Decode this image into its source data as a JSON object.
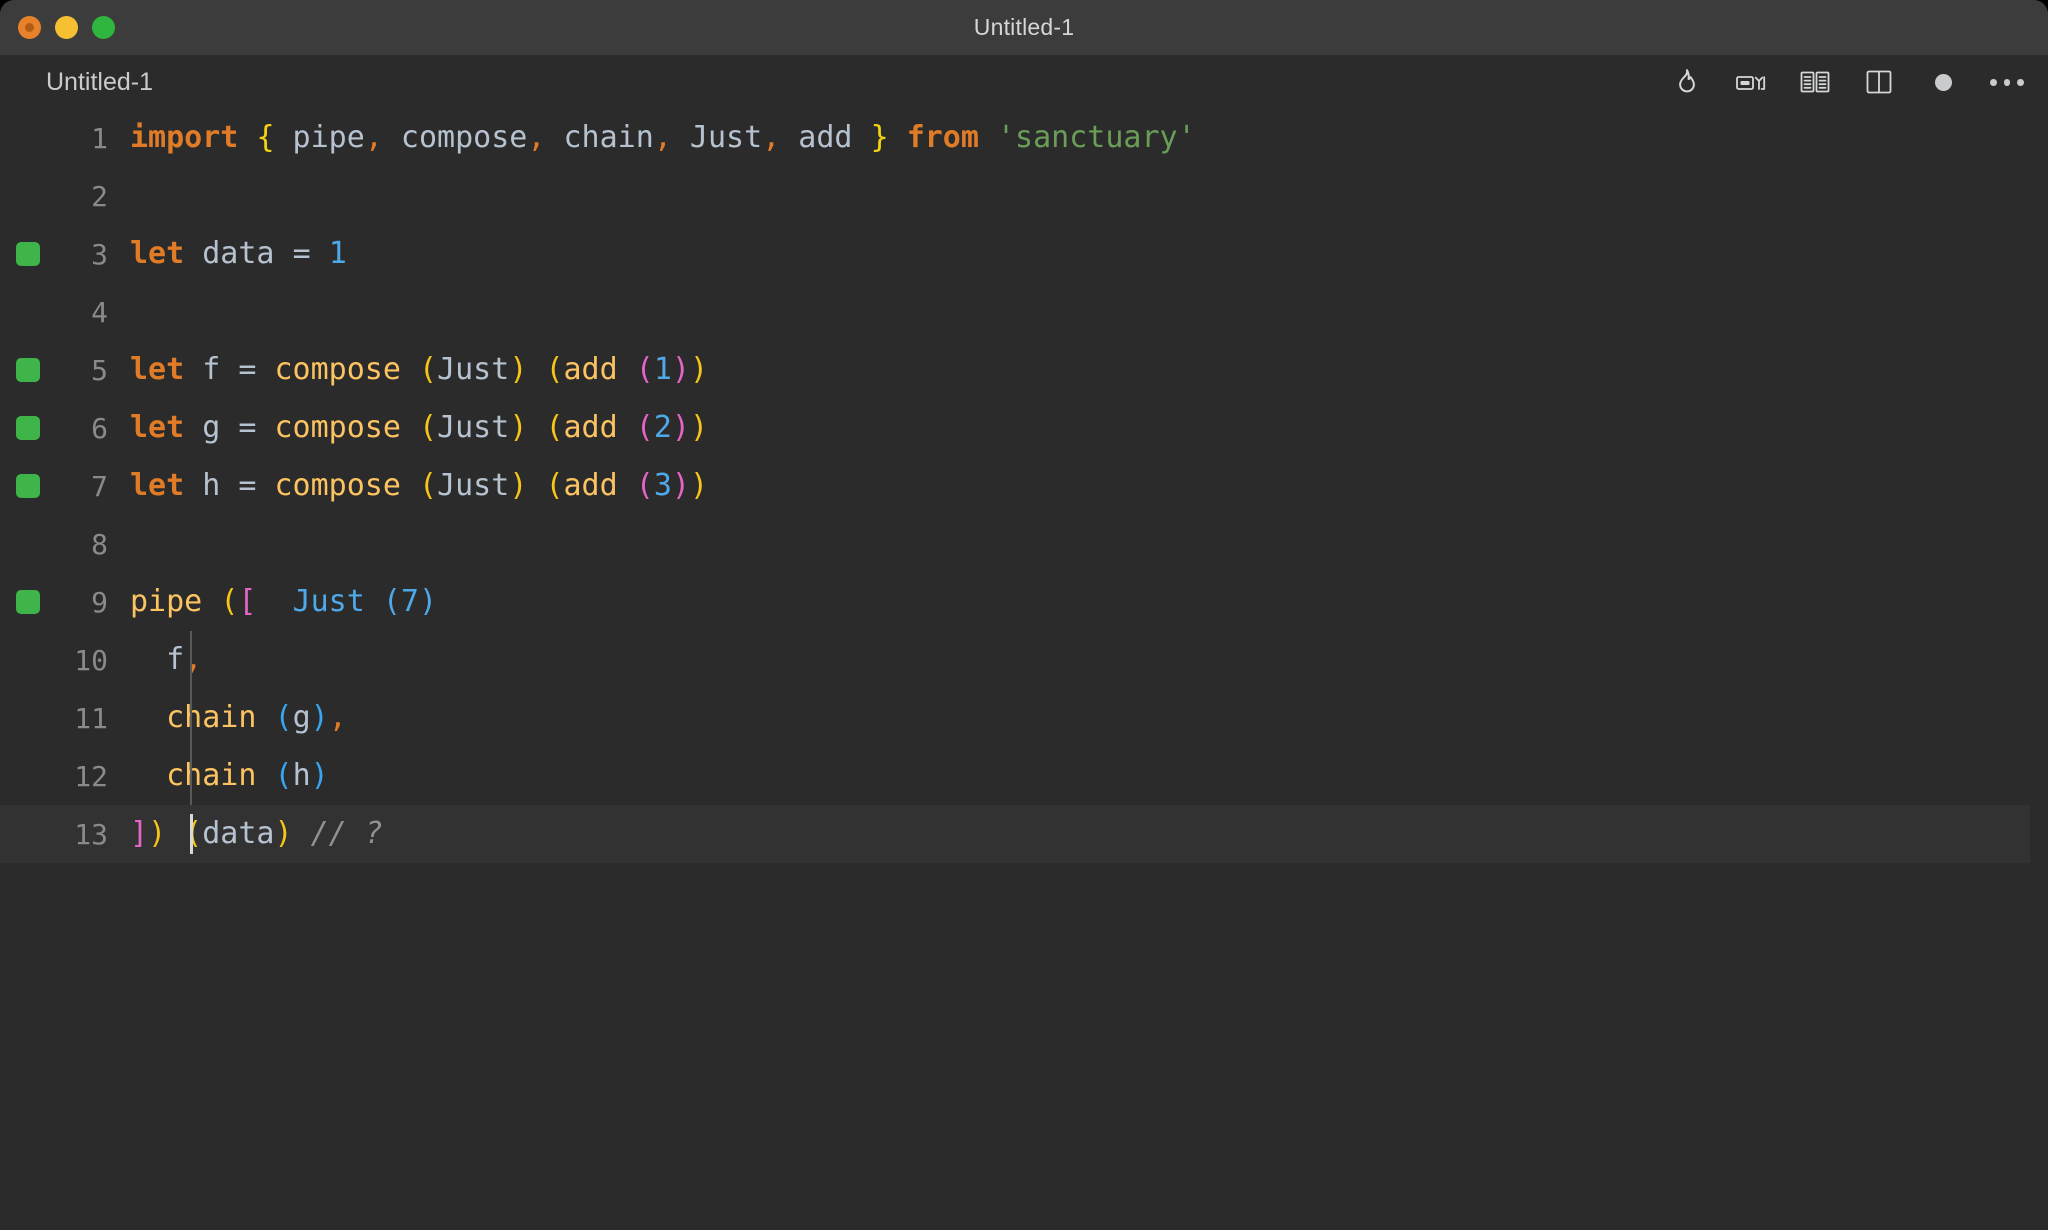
{
  "window": {
    "title": "Untitled-1",
    "traffic_lights": [
      "close-button",
      "minimize-button",
      "maximize-button"
    ]
  },
  "tabbar": {
    "tab_label": "Untitled-1",
    "toolbar_icons": [
      "flame-icon",
      "run-quokka-icon",
      "open-book-icon",
      "split-editor-icon",
      "unsaved-dot-icon",
      "more-actions-icon"
    ]
  },
  "editor": {
    "active_line": 13,
    "gutter_marked_lines": [
      3,
      5,
      6,
      7,
      9
    ],
    "lines": [
      {
        "no": "1",
        "tokens": [
          {
            "text": "import",
            "cls": "t-kw"
          },
          {
            "text": " ",
            "cls": "t-plain"
          },
          {
            "text": "{",
            "cls": "t-brace"
          },
          {
            "text": " pipe",
            "cls": "t-plain"
          },
          {
            "text": ",",
            "cls": "t-punct"
          },
          {
            "text": " compose",
            "cls": "t-plain"
          },
          {
            "text": ",",
            "cls": "t-punct"
          },
          {
            "text": " chain",
            "cls": "t-plain"
          },
          {
            "text": ",",
            "cls": "t-punct"
          },
          {
            "text": " Just",
            "cls": "t-plain"
          },
          {
            "text": ",",
            "cls": "t-punct"
          },
          {
            "text": " add ",
            "cls": "t-plain"
          },
          {
            "text": "}",
            "cls": "t-brace"
          },
          {
            "text": " ",
            "cls": "t-plain"
          },
          {
            "text": "from",
            "cls": "t-kw"
          },
          {
            "text": " ",
            "cls": "t-plain"
          },
          {
            "text": "'sanctuary'",
            "cls": "t-str"
          }
        ]
      },
      {
        "no": "2",
        "tokens": []
      },
      {
        "no": "3",
        "tokens": [
          {
            "text": "let",
            "cls": "t-kw"
          },
          {
            "text": " data ",
            "cls": "t-plain"
          },
          {
            "text": "=",
            "cls": "t-op"
          },
          {
            "text": " ",
            "cls": "t-plain"
          },
          {
            "text": "1",
            "cls": "t-num"
          }
        ]
      },
      {
        "no": "4",
        "tokens": []
      },
      {
        "no": "5",
        "tokens": [
          {
            "text": "let",
            "cls": "t-kw"
          },
          {
            "text": " f ",
            "cls": "t-plain"
          },
          {
            "text": "=",
            "cls": "t-op"
          },
          {
            "text": " ",
            "cls": "t-plain"
          },
          {
            "text": "compose",
            "cls": "t-fn"
          },
          {
            "text": " ",
            "cls": "t-plain"
          },
          {
            "text": "(",
            "cls": "t-paren-y"
          },
          {
            "text": "Just",
            "cls": "t-plain"
          },
          {
            "text": ")",
            "cls": "t-paren-y"
          },
          {
            "text": " ",
            "cls": "t-plain"
          },
          {
            "text": "(",
            "cls": "t-paren-y"
          },
          {
            "text": "add",
            "cls": "t-fn"
          },
          {
            "text": " ",
            "cls": "t-plain"
          },
          {
            "text": "(",
            "cls": "t-paren-p"
          },
          {
            "text": "1",
            "cls": "t-num"
          },
          {
            "text": ")",
            "cls": "t-paren-p"
          },
          {
            "text": ")",
            "cls": "t-paren-y"
          }
        ]
      },
      {
        "no": "6",
        "tokens": [
          {
            "text": "let",
            "cls": "t-kw"
          },
          {
            "text": " g ",
            "cls": "t-plain"
          },
          {
            "text": "=",
            "cls": "t-op"
          },
          {
            "text": " ",
            "cls": "t-plain"
          },
          {
            "text": "compose",
            "cls": "t-fn"
          },
          {
            "text": " ",
            "cls": "t-plain"
          },
          {
            "text": "(",
            "cls": "t-paren-y"
          },
          {
            "text": "Just",
            "cls": "t-plain"
          },
          {
            "text": ")",
            "cls": "t-paren-y"
          },
          {
            "text": " ",
            "cls": "t-plain"
          },
          {
            "text": "(",
            "cls": "t-paren-y"
          },
          {
            "text": "add",
            "cls": "t-fn"
          },
          {
            "text": " ",
            "cls": "t-plain"
          },
          {
            "text": "(",
            "cls": "t-paren-p"
          },
          {
            "text": "2",
            "cls": "t-num"
          },
          {
            "text": ")",
            "cls": "t-paren-p"
          },
          {
            "text": ")",
            "cls": "t-paren-y"
          }
        ]
      },
      {
        "no": "7",
        "tokens": [
          {
            "text": "let",
            "cls": "t-kw"
          },
          {
            "text": " h ",
            "cls": "t-plain"
          },
          {
            "text": "=",
            "cls": "t-op"
          },
          {
            "text": " ",
            "cls": "t-plain"
          },
          {
            "text": "compose",
            "cls": "t-fn"
          },
          {
            "text": " ",
            "cls": "t-plain"
          },
          {
            "text": "(",
            "cls": "t-paren-y"
          },
          {
            "text": "Just",
            "cls": "t-plain"
          },
          {
            "text": ")",
            "cls": "t-paren-y"
          },
          {
            "text": " ",
            "cls": "t-plain"
          },
          {
            "text": "(",
            "cls": "t-paren-y"
          },
          {
            "text": "add",
            "cls": "t-fn"
          },
          {
            "text": " ",
            "cls": "t-plain"
          },
          {
            "text": "(",
            "cls": "t-paren-p"
          },
          {
            "text": "3",
            "cls": "t-num"
          },
          {
            "text": ")",
            "cls": "t-paren-p"
          },
          {
            "text": ")",
            "cls": "t-paren-y"
          }
        ]
      },
      {
        "no": "8",
        "tokens": []
      },
      {
        "no": "9",
        "tokens": [
          {
            "text": "pipe",
            "cls": "t-fn"
          },
          {
            "text": " ",
            "cls": "t-plain"
          },
          {
            "text": "(",
            "cls": "t-paren-y"
          },
          {
            "text": "[",
            "cls": "t-paren-p"
          },
          {
            "text": "  Just (7)",
            "cls": "t-ghost"
          }
        ]
      },
      {
        "no": "10",
        "tokens": [
          {
            "text": "  f",
            "cls": "t-plain"
          },
          {
            "text": ",",
            "cls": "t-punct"
          }
        ]
      },
      {
        "no": "11",
        "tokens": [
          {
            "text": "  ",
            "cls": "t-plain"
          },
          {
            "text": "chain",
            "cls": "t-fn"
          },
          {
            "text": " ",
            "cls": "t-plain"
          },
          {
            "text": "(",
            "cls": "t-paren-b"
          },
          {
            "text": "g",
            "cls": "t-plain"
          },
          {
            "text": ")",
            "cls": "t-paren-b"
          },
          {
            "text": ",",
            "cls": "t-punct"
          }
        ]
      },
      {
        "no": "12",
        "tokens": [
          {
            "text": "  ",
            "cls": "t-plain"
          },
          {
            "text": "chain",
            "cls": "t-fn"
          },
          {
            "text": " ",
            "cls": "t-plain"
          },
          {
            "text": "(",
            "cls": "t-paren-b"
          },
          {
            "text": "h",
            "cls": "t-plain"
          },
          {
            "text": ")",
            "cls": "t-paren-b"
          }
        ]
      },
      {
        "no": "13",
        "tokens": [
          {
            "text": "]",
            "cls": "t-paren-p"
          },
          {
            "text": ")",
            "cls": "t-paren-y"
          },
          {
            "text": " ",
            "cls": "t-plain"
          },
          {
            "text": "(",
            "cls": "t-paren-y"
          },
          {
            "text": "data",
            "cls": "t-plain"
          },
          {
            "text": ")",
            "cls": "t-paren-y"
          },
          {
            "text": " ",
            "cls": "t-plain"
          },
          {
            "text": "// ?",
            "cls": "t-comment"
          }
        ]
      }
    ]
  },
  "colors": {
    "window_chrome": "#3c3c3c",
    "editor_background": "#2b2b2b",
    "active_line_background": "#323232",
    "gutter_marker": "#3fb449",
    "keyword": "#e07b28",
    "function": "#fcc361",
    "string": "#6a9e58",
    "number": "#4fa8e8",
    "comment": "#8e9297",
    "bracket_yellow": "#f5c518",
    "bracket_pink": "#e464c8",
    "bracket_blue": "#39a5f0"
  }
}
